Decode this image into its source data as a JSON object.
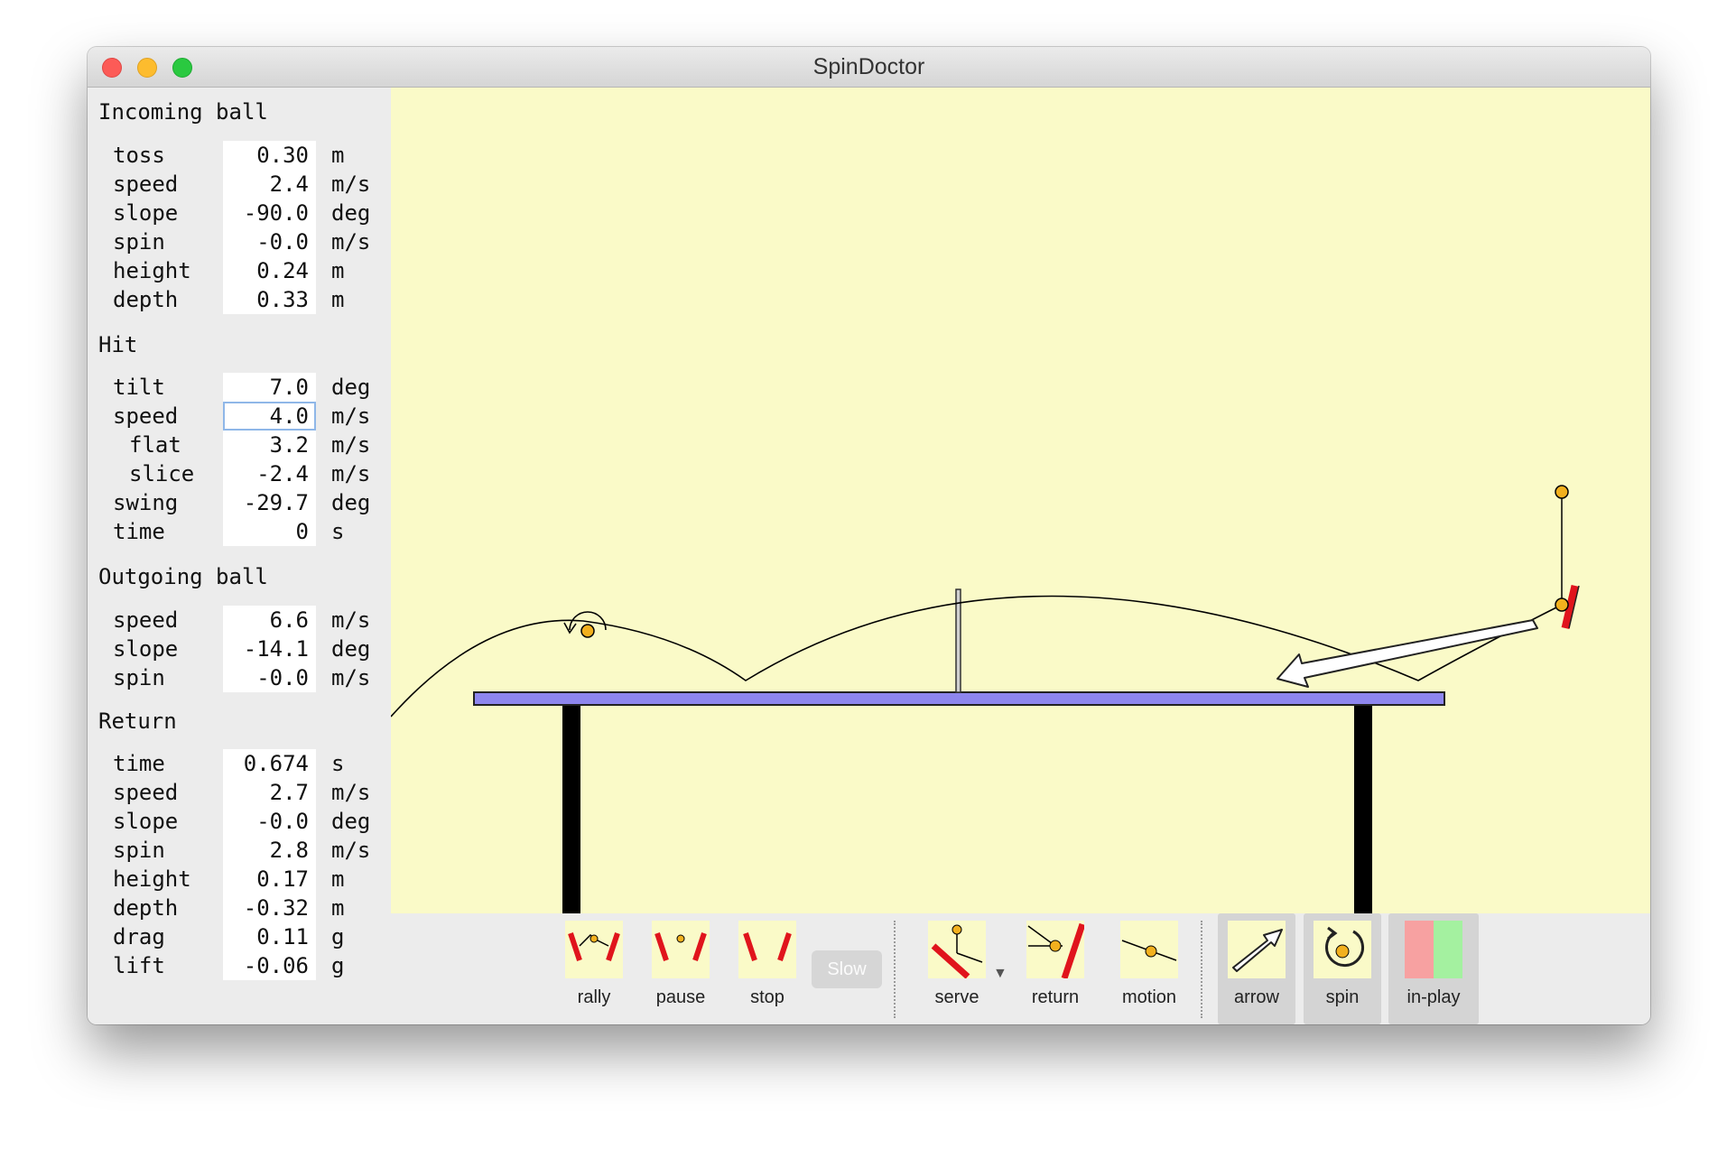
{
  "window": {
    "title": "SpinDoctor"
  },
  "incoming": {
    "title": "Incoming ball",
    "rows": [
      {
        "label": "toss",
        "value": "0.30",
        "unit": "m"
      },
      {
        "label": "speed",
        "value": "2.4",
        "unit": "m/s"
      },
      {
        "label": "slope",
        "value": "-90.0",
        "unit": "deg"
      },
      {
        "label": "spin",
        "value": "-0.0",
        "unit": "m/s"
      },
      {
        "label": "height",
        "value": "0.24",
        "unit": "m"
      },
      {
        "label": "depth",
        "value": "0.33",
        "unit": "m"
      }
    ]
  },
  "hit": {
    "title": "Hit",
    "rows": [
      {
        "label": "tilt",
        "value": "7.0",
        "unit": "deg"
      },
      {
        "label": "speed",
        "value": "4.0",
        "unit": "m/s"
      },
      {
        "label": "flat",
        "value": "3.2",
        "unit": "m/s"
      },
      {
        "label": "slice",
        "value": "-2.4",
        "unit": "m/s"
      },
      {
        "label": "swing",
        "value": "-29.7",
        "unit": "deg"
      },
      {
        "label": "time",
        "value": "0",
        "unit": "s"
      }
    ]
  },
  "outgoing": {
    "title": "Outgoing ball",
    "rows": [
      {
        "label": "speed",
        "value": "6.6",
        "unit": "m/s"
      },
      {
        "label": "slope",
        "value": "-14.1",
        "unit": "deg"
      },
      {
        "label": "spin",
        "value": "-0.0",
        "unit": "m/s"
      }
    ]
  },
  "ret": {
    "title": "Return",
    "rows": [
      {
        "label": "time",
        "value": "0.674",
        "unit": "s"
      },
      {
        "label": "speed",
        "value": "2.7",
        "unit": "m/s"
      },
      {
        "label": "slope",
        "value": "-0.0",
        "unit": "deg"
      },
      {
        "label": "spin",
        "value": "2.8",
        "unit": "m/s"
      },
      {
        "label": "height",
        "value": "0.17",
        "unit": "m"
      },
      {
        "label": "depth",
        "value": "-0.32",
        "unit": "m"
      },
      {
        "label": "drag",
        "value": "0.11",
        "unit": "g"
      },
      {
        "label": "lift",
        "value": "-0.06",
        "unit": "g"
      }
    ]
  },
  "toolbar": {
    "rally": "rally",
    "pause": "pause",
    "stop": "stop",
    "slow": "Slow",
    "serve": "serve",
    "return_label": "return",
    "motion": "motion",
    "arrow": "arrow",
    "spin": "spin",
    "inplay": "in-play"
  },
  "colors": {
    "canvas": "#fafac8",
    "table_top": "#8e86ee",
    "paddle": "#e0141c",
    "ball": "#f2b01e",
    "inplay_left": "#f7a1a1",
    "inplay_right": "#a4f1a0"
  },
  "icons": {
    "close": "close-dot",
    "minimize": "minimize-dot",
    "maximize": "maximize-dot"
  }
}
